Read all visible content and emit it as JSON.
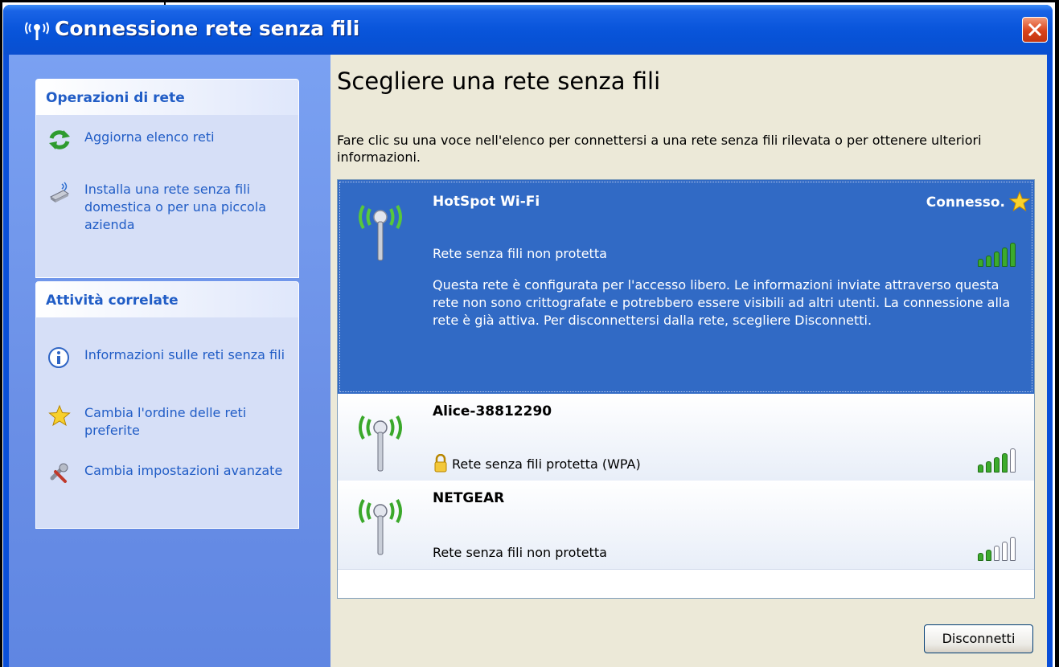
{
  "window": {
    "title": "Connessione rete senza fili",
    "close_label": "Chiudi"
  },
  "sidebar": {
    "network_tasks": {
      "header": "Operazioni di rete",
      "items": [
        {
          "label": "Aggiorna elenco reti",
          "icon": "refresh-icon"
        },
        {
          "label": "Installa una rete senza fili domestica o per una piccola azienda",
          "icon": "wireless-setup-icon"
        }
      ]
    },
    "related_tasks": {
      "header": "Attività correlate",
      "items": [
        {
          "label": "Informazioni sulle reti senza fili",
          "icon": "info-icon"
        },
        {
          "label": "Cambia l'ordine delle reti preferite",
          "icon": "star-icon"
        },
        {
          "label": "Cambia impostazioni avanzate",
          "icon": "settings-tools-icon"
        }
      ]
    }
  },
  "main": {
    "heading": "Scegliere una rete senza fili",
    "instruction": "Fare clic su una voce nell'elenco per connettersi a una rete senza fili rilevata o per ottenere ulteriori informazioni.",
    "networks": [
      {
        "name": "HotSpot Wi-Fi",
        "security": "Rete senza fili non protetta",
        "status": "Connesso.",
        "selected": true,
        "secured": false,
        "signal_bars": 5,
        "description": "Questa rete è configurata per l'accesso libero. Le informazioni inviate attraverso questa rete non sono crittografate e potrebbero essere visibili ad altri utenti. La connessione alla rete è già attiva. Per disconnettersi dalla rete, scegliere Disconnetti."
      },
      {
        "name": "Alice-38812290",
        "security": "Rete senza fili protetta (WPA)",
        "status": "",
        "selected": false,
        "secured": true,
        "signal_bars": 4
      },
      {
        "name": "NETGEAR",
        "security": "Rete senza fili non protetta",
        "status": "",
        "selected": false,
        "secured": false,
        "signal_bars": 2
      }
    ],
    "disconnect_label": "Disconnetti"
  },
  "colors": {
    "titlebar": "#0a56dc",
    "selection": "#316ac5",
    "task_link": "#215dc6",
    "signal_on": "#3cab2c",
    "signal_off": "#ffffff"
  }
}
